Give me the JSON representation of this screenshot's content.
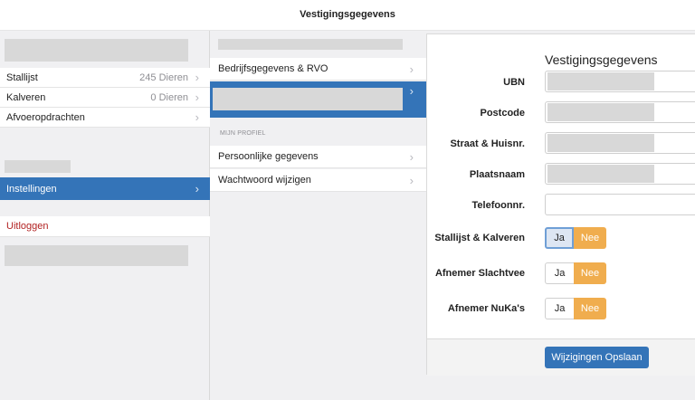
{
  "header": {
    "title": "Vestigingsgegevens"
  },
  "sidebar": {
    "items": [
      {
        "label": "Stallijst",
        "value": "245 Dieren",
        "chevron": "›"
      },
      {
        "label": "Kalveren",
        "value": "0 Dieren",
        "chevron": "›"
      },
      {
        "label": "Afvoeropdrachten",
        "value": "",
        "chevron": "›"
      }
    ],
    "settings": {
      "label": "Instellingen",
      "chevron": "›"
    },
    "logout": {
      "label": "Uitloggen"
    }
  },
  "settings_menu": {
    "items": [
      {
        "label": "Bedrijfsgegevens & RVO",
        "chevron": "›"
      }
    ],
    "selected_chevron": "›",
    "section_header": "MIJN PROFIEL",
    "profile_items": [
      {
        "label": "Persoonlijke gegevens",
        "chevron": "›"
      },
      {
        "label": "Wachtwoord wijzigen",
        "chevron": "›"
      }
    ]
  },
  "form": {
    "title": "Vestigingsgegevens",
    "fields": {
      "ubn": {
        "label": "UBN",
        "value": ""
      },
      "postcode": {
        "label": "Postcode",
        "value": ""
      },
      "street": {
        "label": "Straat & Huisnr.",
        "value": ""
      },
      "city": {
        "label": "Plaatsnaam",
        "value": ""
      },
      "phone": {
        "label": "Telefoonnr.",
        "value": ""
      }
    },
    "toggles": {
      "stallijst": {
        "label": "Stallijst & Kalveren",
        "yes": "Ja",
        "no": "Nee",
        "selected": "Nee"
      },
      "slachtvee": {
        "label": "Afnemer Slachtvee",
        "yes": "Ja",
        "no": "Nee",
        "selected": "Nee"
      },
      "nukas": {
        "label": "Afnemer NuKa's",
        "yes": "Ja",
        "no": "Nee",
        "selected": "Nee"
      }
    },
    "save_label": "Wijzigingen Opslaan"
  },
  "colors": {
    "primary": "#3474b8",
    "accent": "#f0ad4e",
    "logout": "#b22222"
  }
}
